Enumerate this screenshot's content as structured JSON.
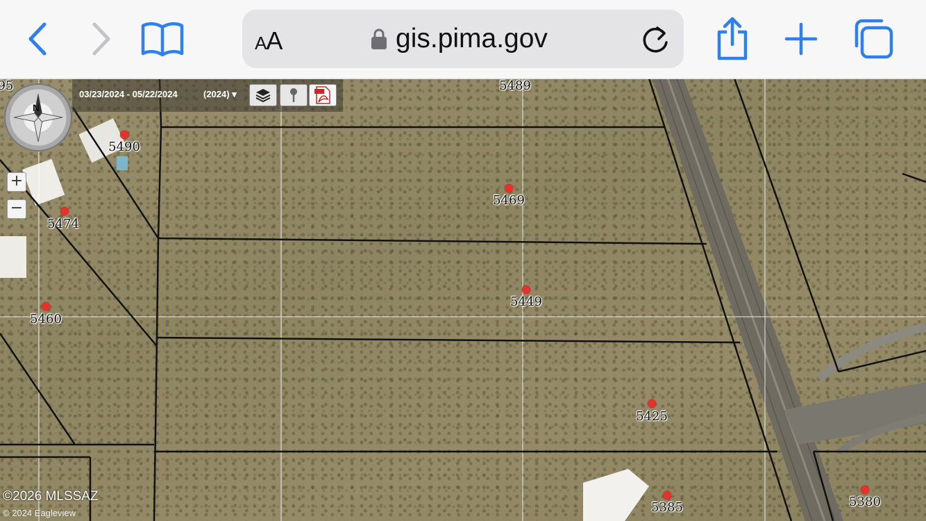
{
  "browser": {
    "text_size_label": "AA",
    "url": "gis.pima.gov"
  },
  "map_toolbar": {
    "date_range": "03/23/2024 - 05/22/2024",
    "year": "(2024)"
  },
  "compass": {
    "north_label": "N"
  },
  "zoom": {
    "in_label": "+",
    "out_label": "−"
  },
  "parcels": [
    {
      "label": "5489"
    },
    {
      "label": "5490"
    },
    {
      "label": "5469"
    },
    {
      "label": "5474"
    },
    {
      "label": "5449"
    },
    {
      "label": "5460"
    },
    {
      "label": "5425"
    },
    {
      "label": "5385"
    },
    {
      "label": "5380"
    },
    {
      "label": "95"
    }
  ],
  "copyright": {
    "mls": "©2026 MLSSAZ",
    "imagery": "© 2024 Eagleview"
  },
  "colors": {
    "pin": "#e8312a",
    "accent": "#2f80ed"
  },
  "icons": [
    "back-icon",
    "forward-icon",
    "bookmarks-icon",
    "lock-icon",
    "reload-icon",
    "share-icon",
    "new-tab-icon",
    "tabs-icon",
    "layers-icon",
    "pin-tool-icon",
    "pdf-icon"
  ]
}
